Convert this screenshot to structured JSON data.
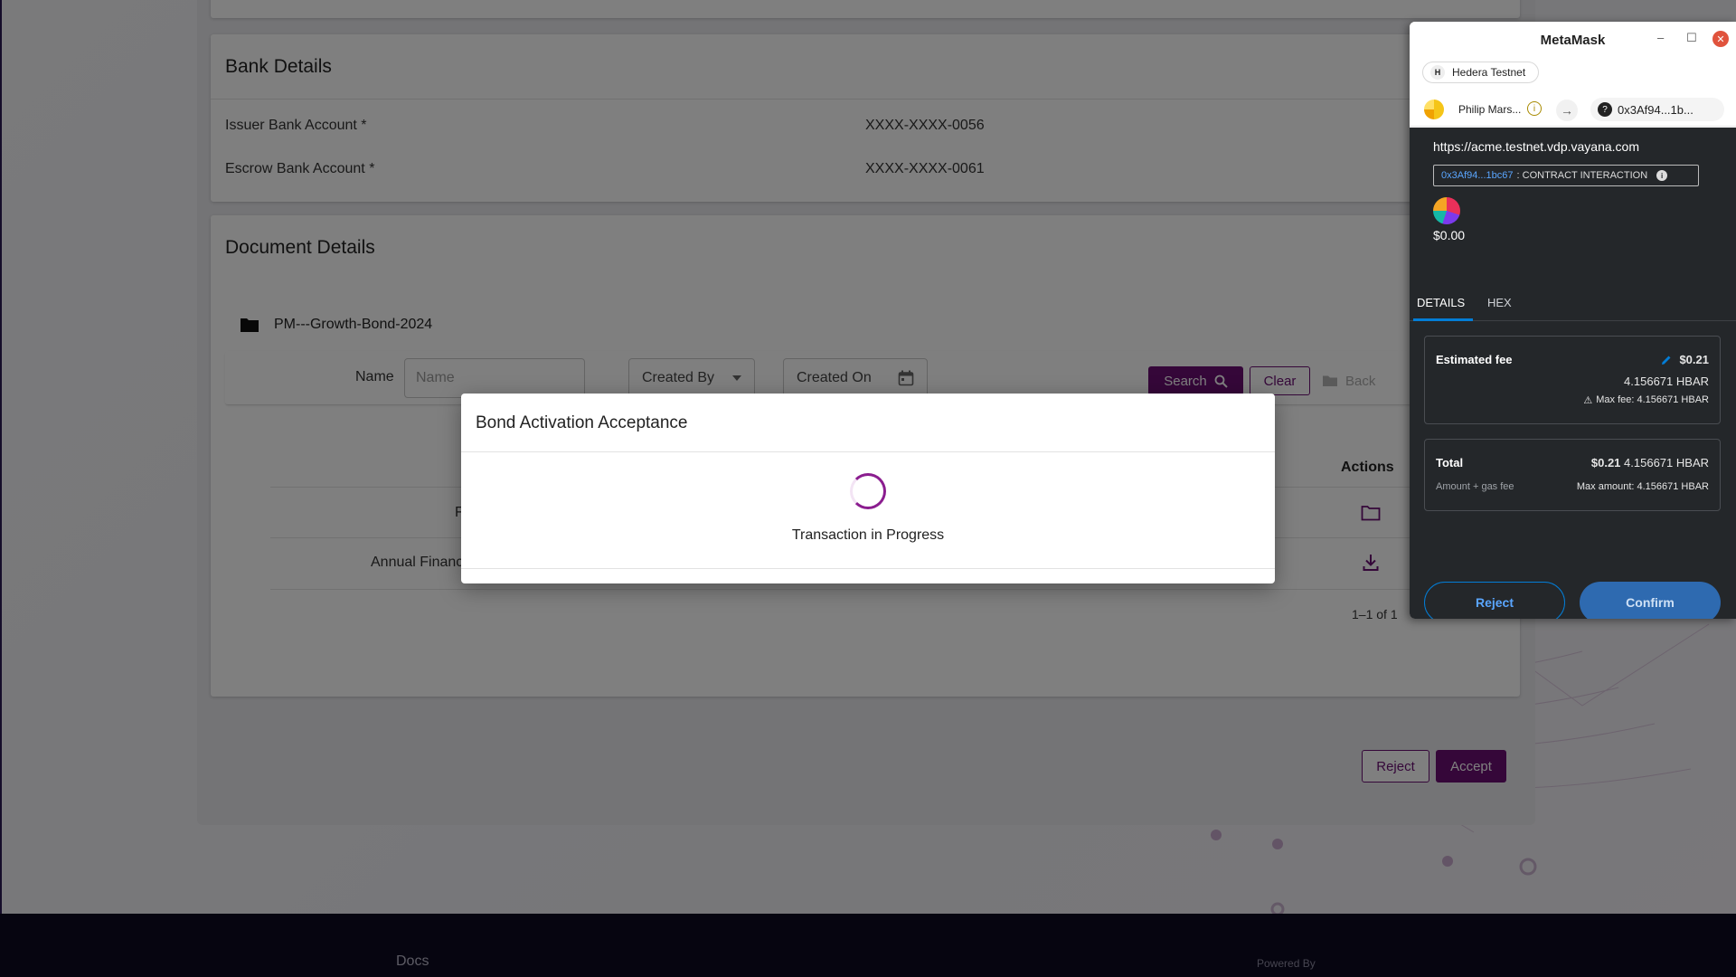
{
  "bank_details": {
    "title": "Bank Details",
    "rows": [
      {
        "label": "Issuer Bank Account *",
        "value": "XXXX-XXXX-0056"
      },
      {
        "label": "Escrow Bank Account *",
        "value": "XXXX-XXXX-0061"
      }
    ]
  },
  "document_details": {
    "title": "Document Details",
    "folder_name": "PM---Growth-Bond-2024",
    "filters": {
      "name_label": "Name",
      "name_placeholder": "Name",
      "created_by": "Created By",
      "created_on": "Created On",
      "search_label": "Search",
      "clear_label": "Clear",
      "back_label": "Back"
    },
    "table": {
      "actions_header": "Actions",
      "rows": [
        {
          "name": "F"
        },
        {
          "name": "Annual Financ"
        }
      ],
      "pagination": "1–1 of 1"
    }
  },
  "page_actions": {
    "reject_label": "Reject",
    "accept_label": "Accept"
  },
  "footer": {
    "docs_label": "Docs",
    "powered_label": "Powered By"
  },
  "modal": {
    "title": "Bond Activation Acceptance",
    "status": "Transaction in Progress"
  },
  "metamask": {
    "window_title": "MetaMask",
    "network": {
      "badge": "H",
      "name": "Hedera Testnet"
    },
    "account_name": "Philip Mars...",
    "destination": "0x3Af94...1b...",
    "origin": "https://acme.testnet.vdp.vayana.com",
    "contract_address": "0x3Af94...1bc67",
    "contract_label": ": CONTRACT INTERACTION",
    "amount": "$0.00",
    "tabs": [
      "DETAILS",
      "HEX"
    ],
    "estimated_fee": {
      "label": "Estimated fee",
      "usd": "$0.21",
      "hbar": "4.156671 HBAR",
      "max_fee": "Max fee: 4.156671 HBAR"
    },
    "total": {
      "label": "Total",
      "sub": "Amount + gas fee",
      "usd": "$0.21",
      "hbar": "4.156671 HBAR",
      "max_amount": "Max amount: 4.156671 HBAR"
    },
    "reject_label": "Reject",
    "confirm_label": "Confirm",
    "colors": {
      "accent": "#037dd6",
      "panel": "#24272a"
    }
  },
  "colors": {
    "brand": "#6a0f73",
    "footer": "#0d0a20"
  }
}
